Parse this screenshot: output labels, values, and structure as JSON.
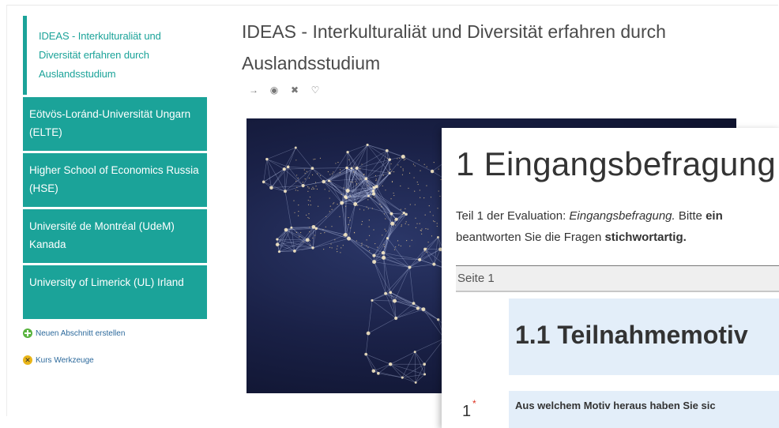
{
  "sidebar": {
    "active_item": "IDEAS - Interkulturaliät und Diversität erfahren durch Auslandsstudium",
    "items": [
      {
        "label": "Eötvös-Loránd-Universität Ungarn (ELTE)"
      },
      {
        "label": "Higher School of Economics Russia (HSE)"
      },
      {
        "label": "Université de Montréal (UdeM) Kanada"
      },
      {
        "label": "University of Limerick (UL) Irland"
      }
    ],
    "new_section_label": "Neuen Abschnitt erstellen",
    "course_tools_label": "Kurs Werkzeuge"
  },
  "course": {
    "title": "IDEAS - Interkulturaliät und Diversität erfahren durch Auslandsstudium",
    "actions": [
      {
        "icon": "arrow-right-icon",
        "glyph": "→"
      },
      {
        "icon": "eye-icon",
        "glyph": "◉"
      },
      {
        "icon": "close-icon",
        "glyph": "✖"
      },
      {
        "icon": "marker-icon",
        "glyph": "♡"
      }
    ]
  },
  "survey": {
    "title": "1 Eingangsbefragung",
    "intro_part1": "Teil 1 der Evaluation: ",
    "intro_em": "Eingangsbefragung.",
    "intro_part2": " Bitte ",
    "intro_strong1": "ein",
    "intro_line2": "beantworten Sie die Fragen ",
    "intro_strong2": "stichwortartig.",
    "page_label": "Seite 1",
    "section_title": "1.1 Teilnahmemotiv",
    "question_number": "1",
    "question_required_mark": "*",
    "question_text": "Aus welchem Motiv heraus haben Sie sic"
  },
  "colors": {
    "accent": "#1ba399",
    "section_bg": "#e3eef9",
    "required": "#d32222"
  }
}
